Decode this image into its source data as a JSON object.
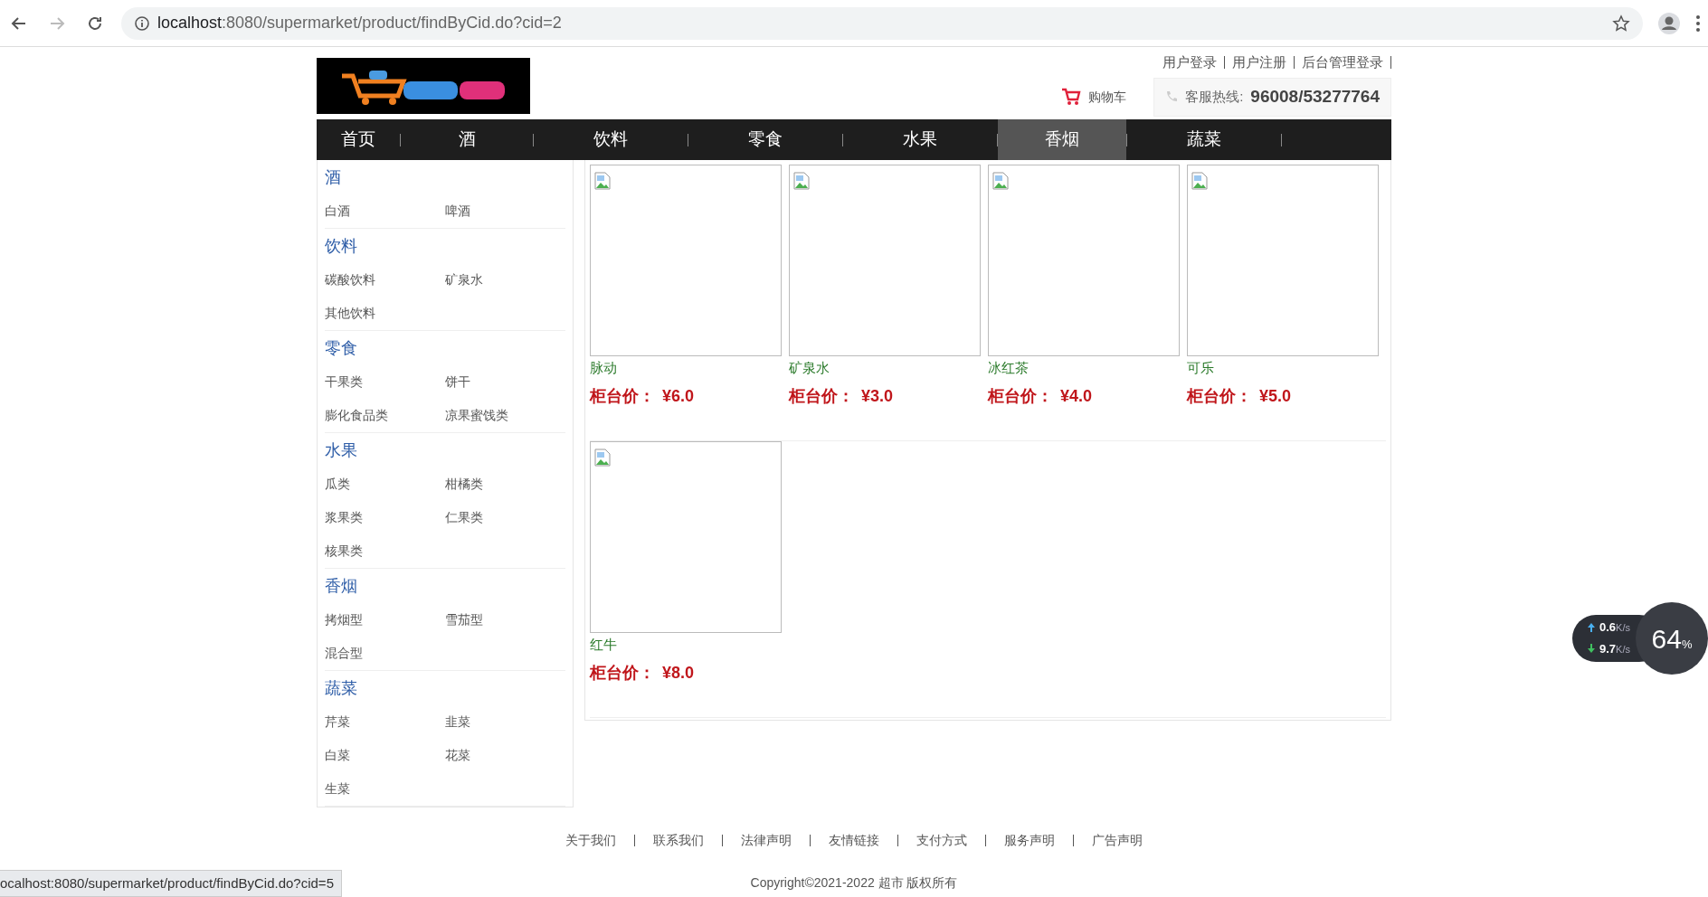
{
  "browser": {
    "url_host": "localhost",
    "url_rest": ":8080/supermarket/product/findByCid.do?cid=2",
    "status_url": "ocalhost:8080/supermarket/product/findByCid.do?cid=5"
  },
  "header": {
    "top_links": [
      "用户登录",
      "用户注册",
      "后台管理登录"
    ],
    "cart_label": "购物车",
    "hotline_label": "客服热线:",
    "hotline_number": "96008/53277764"
  },
  "nav": [
    {
      "label": "首页",
      "selected": false
    },
    {
      "label": "酒",
      "selected": false
    },
    {
      "label": "饮料",
      "selected": false
    },
    {
      "label": "零食",
      "selected": false
    },
    {
      "label": "水果",
      "selected": false
    },
    {
      "label": "香烟",
      "selected": true
    },
    {
      "label": "蔬菜",
      "selected": false
    }
  ],
  "sidebar": [
    {
      "title": "酒",
      "items": [
        "白酒",
        "啤酒"
      ]
    },
    {
      "title": "饮料",
      "items": [
        "碳酸饮料",
        "矿泉水",
        "其他饮料"
      ]
    },
    {
      "title": "零食",
      "items": [
        "干果类",
        "饼干",
        "膨化食品类",
        "凉果蜜饯类"
      ]
    },
    {
      "title": "水果",
      "items": [
        "瓜类",
        "柑橘类",
        "浆果类",
        "仁果类",
        "核果类"
      ]
    },
    {
      "title": "香烟",
      "items": [
        "拷烟型",
        "雪茄型",
        "混合型"
      ]
    },
    {
      "title": "蔬菜",
      "items": [
        "芹菜",
        "韭菜",
        "白菜",
        "花菜",
        "生菜"
      ]
    }
  ],
  "products": [
    {
      "name": "脉动",
      "price_label": "柜台价：",
      "price": "¥6.0"
    },
    {
      "name": "矿泉水",
      "price_label": "柜台价：",
      "price": "¥3.0"
    },
    {
      "name": "冰红茶",
      "price_label": "柜台价：",
      "price": "¥4.0"
    },
    {
      "name": "可乐",
      "price_label": "柜台价：",
      "price": "¥5.0"
    },
    {
      "name": "红牛",
      "price_label": "柜台价：",
      "price": "¥8.0"
    }
  ],
  "footer": {
    "links": [
      "关于我们",
      "联系我们",
      "法律声明",
      "友情链接",
      "支付方式",
      "服务声明",
      "广告声明"
    ],
    "copyright": "Copyright©2021-2022 超市 版权所有"
  },
  "net_widget": {
    "up": "0.6",
    "up_unit": "K/s",
    "down": "9.7",
    "down_unit": "K/s",
    "percent": "64",
    "percent_unit": "%"
  }
}
